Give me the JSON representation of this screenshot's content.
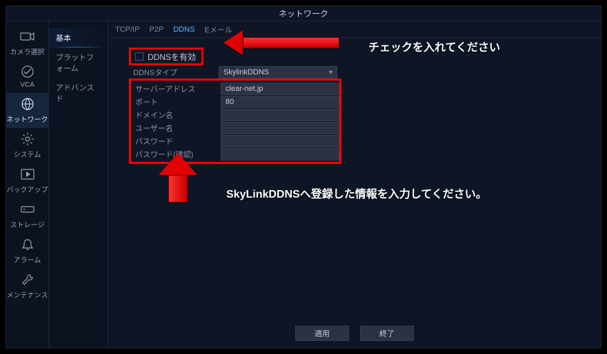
{
  "window": {
    "title": "ネットワーク"
  },
  "leftnav": {
    "items": [
      {
        "id": "camera",
        "label": "カメラ選択"
      },
      {
        "id": "vca",
        "label": "VCA"
      },
      {
        "id": "network",
        "label": "ネットワーク"
      },
      {
        "id": "system",
        "label": "システム"
      },
      {
        "id": "backup",
        "label": "バックアップ"
      },
      {
        "id": "storage",
        "label": "ストレージ"
      },
      {
        "id": "alarm",
        "label": "アラーム"
      },
      {
        "id": "maint",
        "label": "メンテナンス"
      }
    ],
    "active": "network"
  },
  "subnav": {
    "items": [
      {
        "id": "basic",
        "label": "基本"
      },
      {
        "id": "platform",
        "label": "プラットフォーム"
      },
      {
        "id": "advanced",
        "label": "アドバンスド"
      }
    ],
    "active": "basic"
  },
  "tabs": {
    "items": [
      {
        "id": "tcpip",
        "label": "TCP/IP"
      },
      {
        "id": "p2p",
        "label": "P2P"
      },
      {
        "id": "ddns",
        "label": "DDNS"
      },
      {
        "id": "email",
        "label": "Eメール"
      }
    ],
    "active": "ddns"
  },
  "ddns": {
    "enable_label": "DDNSを有効",
    "type_label": "DDNSタイプ",
    "type_value": "SkylinkDDNS",
    "fields": [
      {
        "label": "サーバーアドレス",
        "value": "clear-net.jp"
      },
      {
        "label": "ポート",
        "value": "80"
      },
      {
        "label": "ドメイン名",
        "value": ""
      },
      {
        "label": "ユーザー名",
        "value": ""
      },
      {
        "label": "パスワード",
        "value": ""
      },
      {
        "label": "パスワード(確認)",
        "value": ""
      }
    ]
  },
  "buttons": {
    "apply": "適用",
    "exit": "終了"
  },
  "annotations": {
    "enable_hint": "チェックを入れてください",
    "fields_hint": "SkyLinkDDNSへ登録した情報を入力してください。"
  },
  "colors": {
    "highlight": "#ff0000",
    "bg": "#0e1626",
    "panel": "#2a3244"
  }
}
